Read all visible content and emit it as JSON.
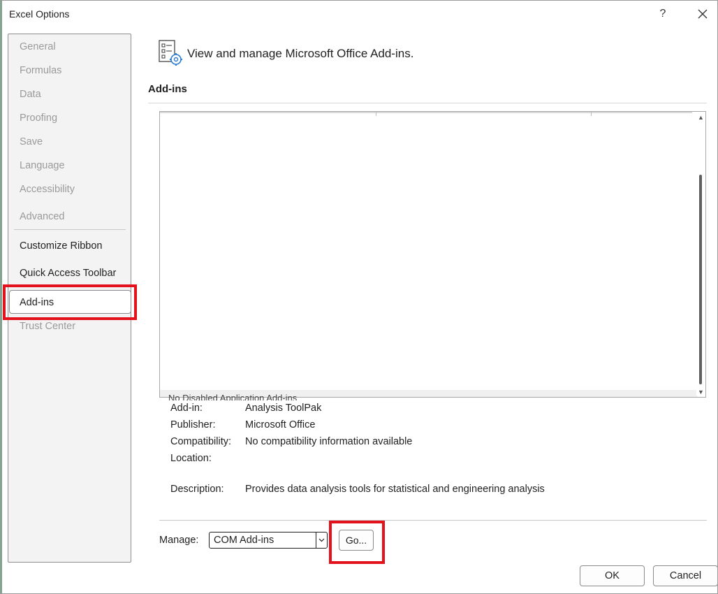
{
  "window": {
    "title": "Excel Options",
    "help_label": "?",
    "close_label": "✕"
  },
  "sidebar": {
    "items": [
      {
        "label": "General",
        "enabled": false
      },
      {
        "label": "Formulas",
        "enabled": false
      },
      {
        "label": "Data",
        "enabled": false
      },
      {
        "label": "Proofing",
        "enabled": false
      },
      {
        "label": "Save",
        "enabled": false
      },
      {
        "label": "Language",
        "enabled": false
      },
      {
        "label": "Accessibility",
        "enabled": false
      },
      {
        "label": "Advanced",
        "enabled": false
      },
      {
        "label": "Customize Ribbon",
        "enabled": true
      },
      {
        "label": "Quick Access Toolbar",
        "enabled": true
      },
      {
        "label": "Add-ins",
        "enabled": true,
        "selected": true
      },
      {
        "label": "Trust Center",
        "enabled": false
      }
    ]
  },
  "header": {
    "text": "View and manage Microsoft Office Add-ins."
  },
  "section": {
    "title": "Add-ins"
  },
  "list": {
    "partial_row_text": "No Disabled Application Add-ins"
  },
  "details": {
    "addin_label": "Add-in:",
    "addin_value": "Analysis ToolPak",
    "publisher_label": "Publisher:",
    "publisher_value": "Microsoft Office",
    "compat_label": "Compatibility:",
    "compat_value": "No compatibility information available",
    "location_label": "Location:",
    "description_label": "Description:",
    "description_value": "Provides data analysis tools for statistical and engineering analysis"
  },
  "manage": {
    "label": "Manage:",
    "selected": "COM Add-ins",
    "go_label": "Go..."
  },
  "footer": {
    "ok_label": "OK",
    "cancel_label": "Cancel"
  },
  "colors": {
    "highlight": "#e3121d",
    "icon_accent": "#2b7cd3"
  }
}
